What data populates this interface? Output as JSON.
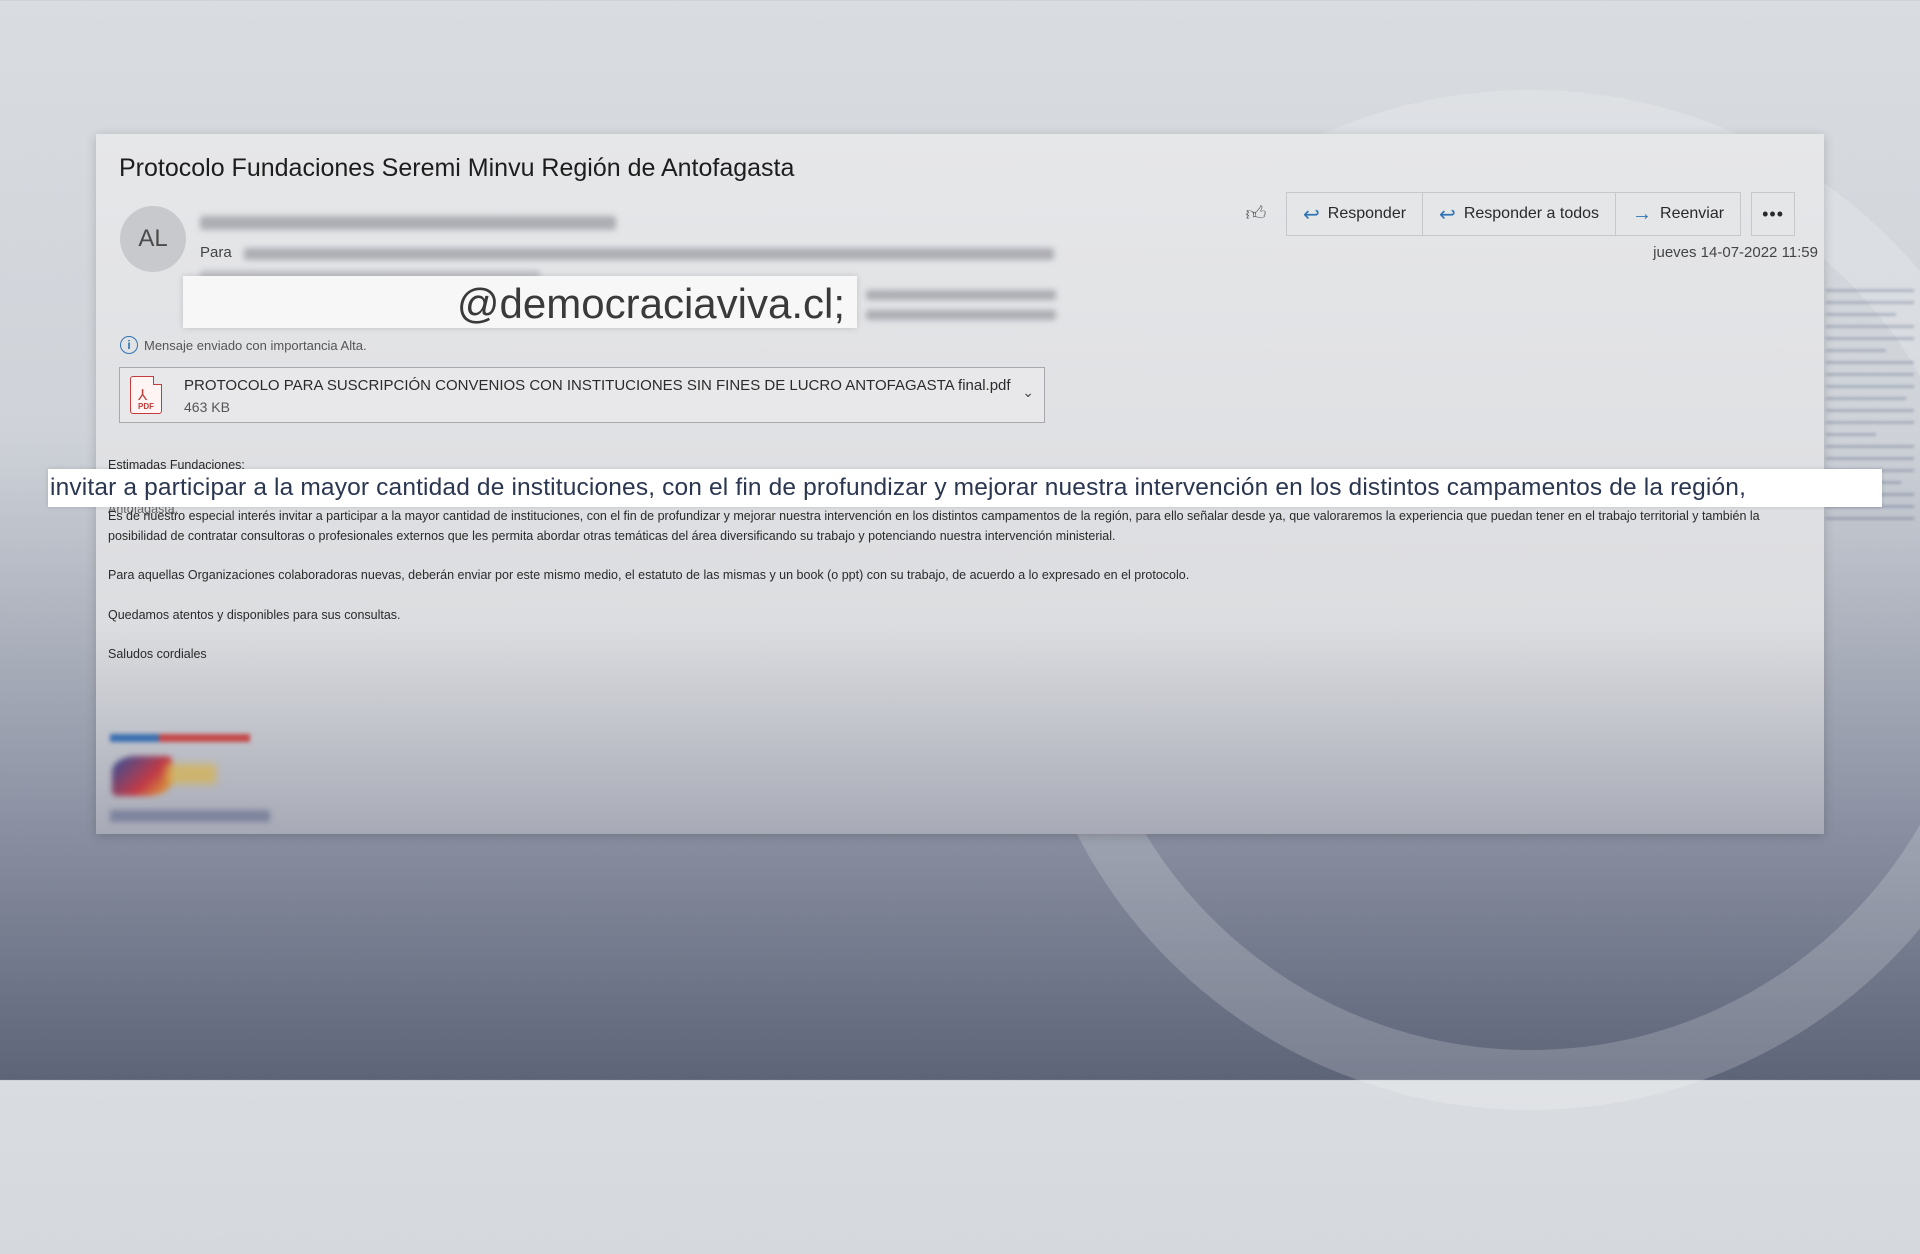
{
  "email": {
    "subject": "Protocolo Fundaciones Seremi Minvu Región de Antofagasta",
    "sender_initials": "AL",
    "to_label": "Para",
    "revealed_recipient": "@democraciaviva.cl;",
    "importance_text": "Mensaje enviado con importancia Alta.",
    "date": "jueves 14-07-2022 11:59"
  },
  "toolbar": {
    "reply_label": "Responder",
    "reply_all_label": "Responder a todos",
    "forward_label": "Reenviar",
    "more_label": "•••"
  },
  "attachment": {
    "name": "PROTOCOLO PARA SUSCRIPCIÓN CONVENIOS CON INSTITUCIONES SIN FINES DE LUCRO ANTOFAGASTA final.pdf",
    "size": "463 KB",
    "type_label": "PDF"
  },
  "body": {
    "greeting": "Estimadas Fundaciones:",
    "cut_line": "Antofagasta.",
    "paragraph1": "Es de nuestro especial interés invitar a participar a la mayor cantidad de instituciones, con el fin de profundizar y mejorar nuestra intervención en los distintos campamentos de la región, para ello señalar desde ya, que valoraremos la experiencia que puedan tener en el trabajo territorial y también la posibilidad de contratar consultoras o profesionales externos que les permita abordar otras temáticas del área diversificando su trabajo y potenciando nuestra intervención ministerial.",
    "paragraph2": "Para aquellas Organizaciones colaboradoras nuevas, deberán enviar por este mismo medio, el estatuto de las mismas y un book (o ppt) con su trabajo, de acuerdo a lo expresado en el protocolo.",
    "paragraph3": "Quedamos atentos y disponibles para sus consultas.",
    "closing": "Saludos cordiales"
  },
  "highlight": {
    "text": "invitar a participar a la mayor cantidad de instituciones, con el fin de profundizar y mejorar nuestra intervención en los distintos campamentos de la región,"
  }
}
